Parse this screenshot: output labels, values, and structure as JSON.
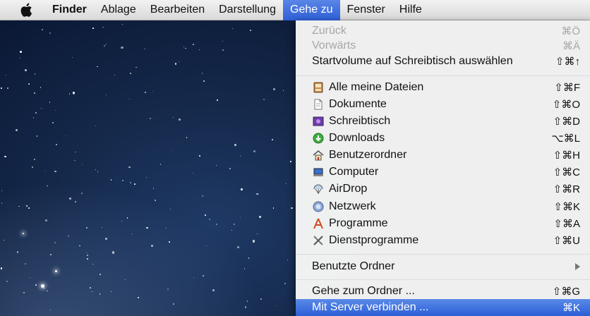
{
  "menubar": {
    "apple_icon": "apple-logo-icon",
    "items": [
      {
        "label": "Finder"
      },
      {
        "label": "Ablage"
      },
      {
        "label": "Bearbeiten"
      },
      {
        "label": "Darstellung"
      },
      {
        "label": "Gehe zu"
      },
      {
        "label": "Fenster"
      },
      {
        "label": "Hilfe"
      }
    ]
  },
  "dropdown": {
    "back": {
      "label": "Zurück",
      "shortcut": "⌘Ö"
    },
    "forward": {
      "label": "Vorwärts",
      "shortcut": "⌘Ä"
    },
    "startup": {
      "label": "Startvolume auf Schreibtisch auswählen",
      "shortcut": "⇧⌘↑"
    },
    "places": [
      {
        "label": "Alle meine Dateien",
        "shortcut": "⇧⌘F",
        "icon": "all-files-icon"
      },
      {
        "label": "Dokumente",
        "shortcut": "⇧⌘O",
        "icon": "document-icon"
      },
      {
        "label": "Schreibtisch",
        "shortcut": "⇧⌘D",
        "icon": "desktop-icon"
      },
      {
        "label": "Downloads",
        "shortcut": "⌥⌘L",
        "icon": "downloads-icon"
      },
      {
        "label": "Benutzerordner",
        "shortcut": "⇧⌘H",
        "icon": "home-icon"
      },
      {
        "label": "Computer",
        "shortcut": "⇧⌘C",
        "icon": "computer-icon"
      },
      {
        "label": "AirDrop",
        "shortcut": "⇧⌘R",
        "icon": "airdrop-icon"
      },
      {
        "label": "Netzwerk",
        "shortcut": "⇧⌘K",
        "icon": "network-icon"
      },
      {
        "label": "Programme",
        "shortcut": "⇧⌘A",
        "icon": "applications-icon"
      },
      {
        "label": "Dienstprogramme",
        "shortcut": "⇧⌘U",
        "icon": "utilities-icon"
      }
    ],
    "recent": {
      "label": "Benutzte Ordner"
    },
    "goto_folder": {
      "label": "Gehe zum Ordner ...",
      "shortcut": "⇧⌘G"
    },
    "connect_server": {
      "label": "Mit Server verbinden ...",
      "shortcut": "⌘K"
    }
  },
  "colors": {
    "highlight": "#2e5fd6",
    "menubar": "#e6e6e6"
  }
}
